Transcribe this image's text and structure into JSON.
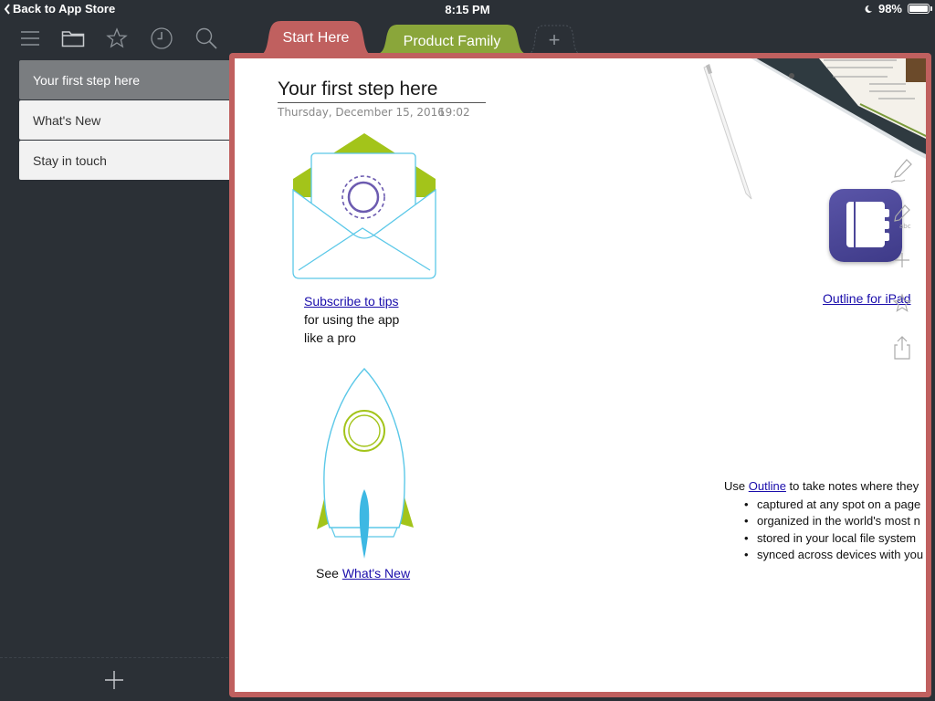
{
  "status_bar": {
    "back_label": "Back to App Store",
    "time": "8:15 PM",
    "battery": "98%",
    "battery_level": 0.98
  },
  "toolbar": {
    "icons": [
      "menu-icon",
      "folder-icon",
      "star-icon",
      "clock-icon",
      "search-icon"
    ]
  },
  "sidebar": {
    "items": [
      {
        "label": "Your first step here",
        "active": true
      },
      {
        "label": "What's New",
        "active": false
      },
      {
        "label": "Stay in touch",
        "active": false
      }
    ],
    "add_icon": "plus-icon"
  },
  "tabs": [
    {
      "label": "Start Here",
      "color": "#c0605f",
      "active": true
    },
    {
      "label": "Product Family",
      "color": "#8aa63a",
      "active": false
    },
    {
      "label": "+",
      "color": "#2b3036",
      "active": false
    }
  ],
  "page": {
    "title": "Your first step here",
    "date": "Thursday, December 15, 2016",
    "time": "19:02",
    "subscribe_link": "Subscribe to tips",
    "subscribe_line2": "for using the app",
    "subscribe_line3": "like a pro",
    "see_prefix": "See ",
    "whats_new_link": "What's New",
    "outline_ipad_link": "Outline for iPad",
    "use_prefix": "Use ",
    "use_link": "Outline",
    "use_suffix": " to take notes where they",
    "bullets": [
      "captured at any spot on a page",
      "organized in the world's most n",
      "stored in your local file system",
      "synced across devices with you"
    ]
  },
  "colors": {
    "sidebar_bg": "#2b3036",
    "accent_red": "#c0605f",
    "accent_green": "#8aa63a",
    "link": "#1a0dab"
  }
}
